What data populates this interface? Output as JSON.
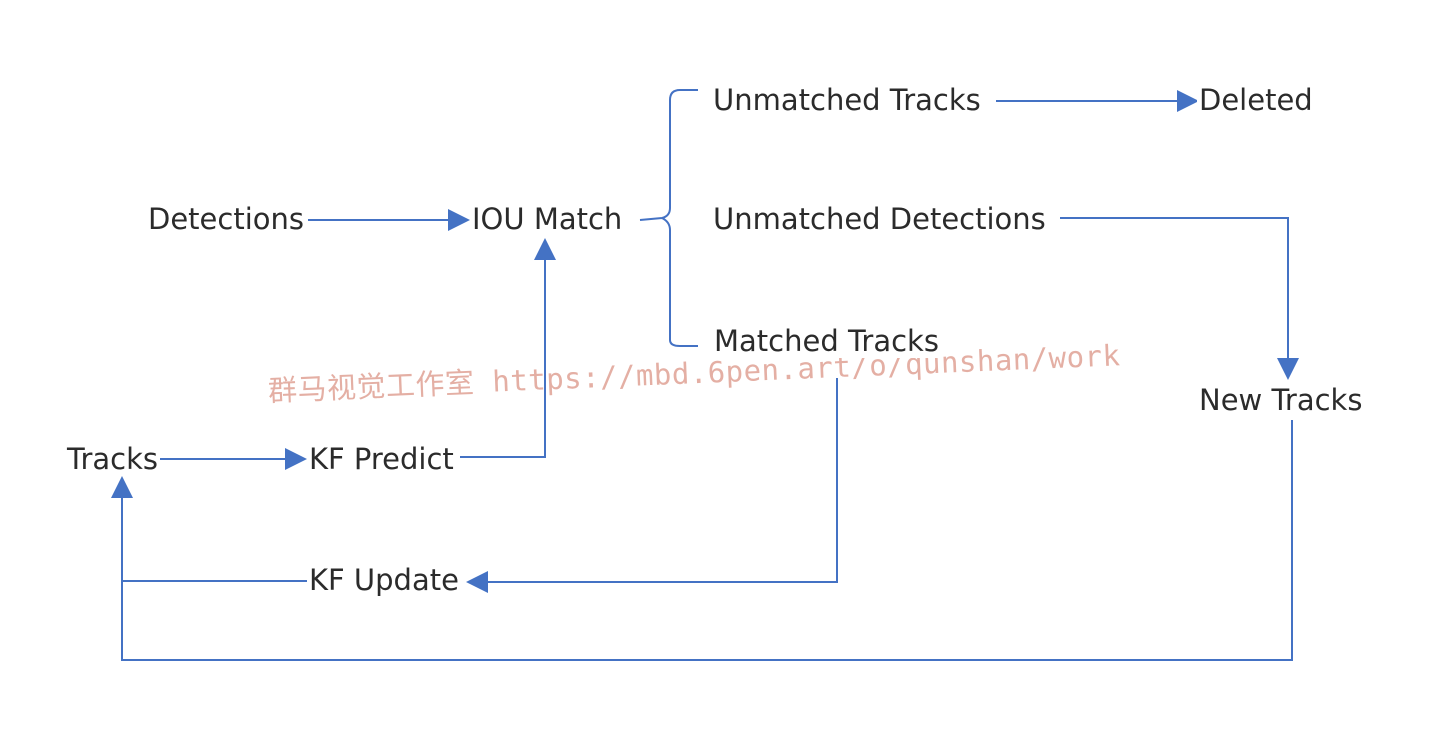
{
  "diagram": {
    "nodes": {
      "detections": "Detections",
      "iou_match": "IOU Match",
      "unmatched_tracks": "Unmatched Tracks",
      "deleted": "Deleted",
      "unmatched_detections": "Unmatched Detections",
      "matched_tracks": "Matched Tracks",
      "new_tracks": "New Tracks",
      "tracks": "Tracks",
      "kf_predict": "KF Predict",
      "kf_update": "KF Update"
    },
    "edges": [
      {
        "from": "detections",
        "to": "iou_match"
      },
      {
        "from": "kf_predict",
        "to": "iou_match"
      },
      {
        "from": "iou_match",
        "to": "unmatched_tracks"
      },
      {
        "from": "iou_match",
        "to": "unmatched_detections"
      },
      {
        "from": "iou_match",
        "to": "matched_tracks"
      },
      {
        "from": "unmatched_tracks",
        "to": "deleted"
      },
      {
        "from": "unmatched_detections",
        "to": "new_tracks"
      },
      {
        "from": "matched_tracks",
        "to": "kf_update"
      },
      {
        "from": "kf_update",
        "to": "tracks"
      },
      {
        "from": "new_tracks",
        "to": "tracks"
      },
      {
        "from": "tracks",
        "to": "kf_predict"
      }
    ],
    "colors": {
      "line": "#4472c4",
      "text": "#2b2b2b",
      "watermark": "#cd6e5a"
    }
  },
  "watermark": {
    "text": "群马视觉工作室 https://mbd.6pen.art/o/qunshan/work"
  }
}
